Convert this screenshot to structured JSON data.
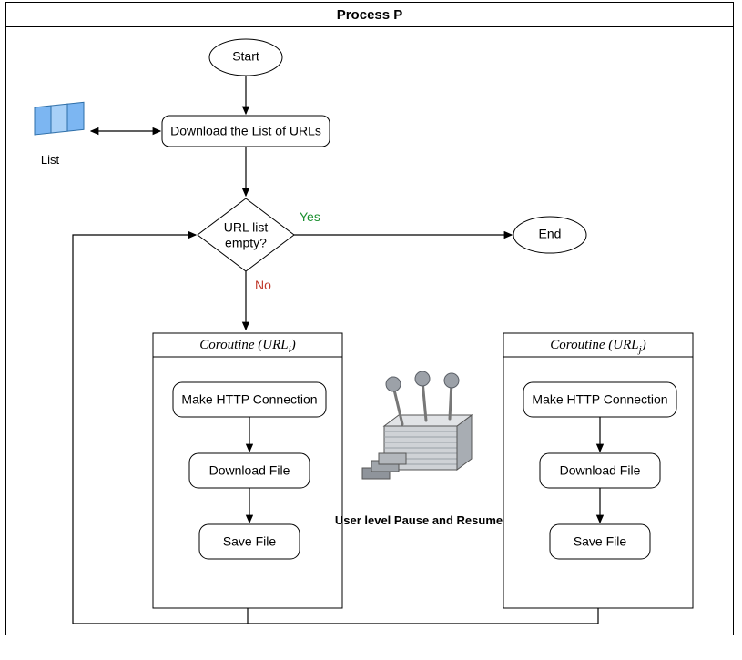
{
  "title": "Process P",
  "start_label": "Start",
  "end_label": "End",
  "download_label": "Download the List of URLs",
  "list_label": "List",
  "decision_line1": "URL list",
  "decision_line2": "empty?",
  "yes_label": "Yes",
  "no_label": "No",
  "coroutine_i_prefix": "Coroutine (URL",
  "coroutine_i_sub": "i",
  "coroutine_i_suffix": ")",
  "coroutine_j_prefix": "Coroutine (URL",
  "coroutine_j_sub": "j",
  "coroutine_j_suffix": ")",
  "step_http": "Make HTTP Connection",
  "step_download": "Download File",
  "step_save": "Save File",
  "mid_caption": "User level Pause and Resume"
}
